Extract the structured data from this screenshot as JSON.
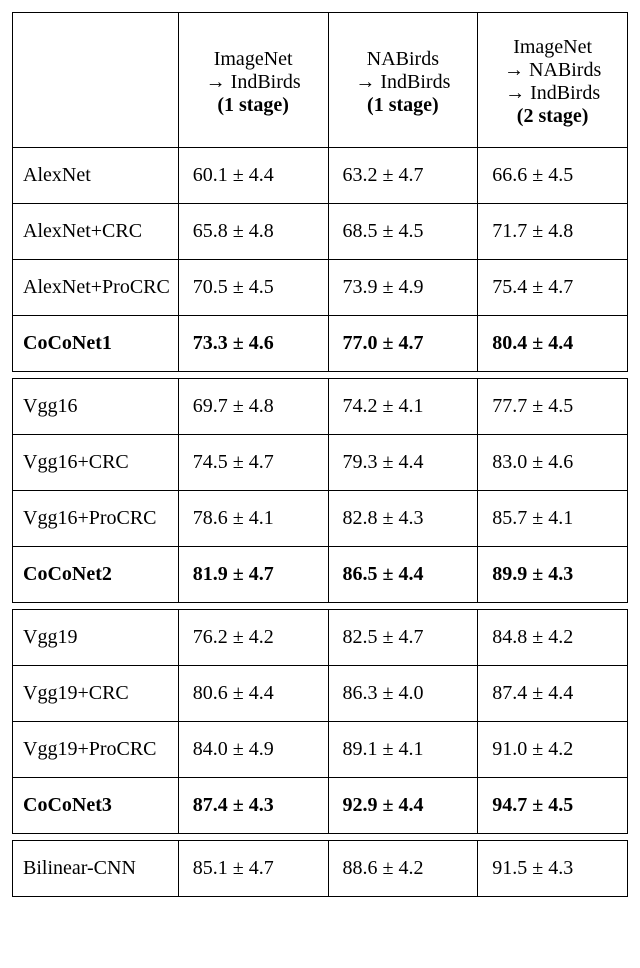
{
  "headers": {
    "method": "",
    "c1": {
      "l1": "ImageNet",
      "l2": "→ IndBirds",
      "l3": "(1 stage)"
    },
    "c2": {
      "l1": "NABirds",
      "l2": "→ IndBirds",
      "l3": "(1 stage)"
    },
    "c3": {
      "l1": "ImageNet",
      "l2": "→ NABirds",
      "l3": "→ IndBirds",
      "l4": "(2 stage)"
    }
  },
  "groups": [
    [
      {
        "name": "AlexNet",
        "v": [
          "60.1 ± 4.4",
          "63.2 ± 4.7",
          "66.6 ± 4.5"
        ],
        "bold": false
      },
      {
        "name": "AlexNet+CRC",
        "v": [
          "65.8 ± 4.8",
          "68.5 ± 4.5",
          "71.7 ± 4.8"
        ],
        "bold": false
      },
      {
        "name": "AlexNet+ProCRC",
        "v": [
          "70.5 ± 4.5",
          "73.9 ± 4.9",
          "75.4 ± 4.7"
        ],
        "bold": false
      },
      {
        "name": "CoCoNet1",
        "v": [
          "73.3 ± 4.6",
          "77.0 ± 4.7",
          "80.4 ± 4.4"
        ],
        "bold": true
      }
    ],
    [
      {
        "name": "Vgg16",
        "v": [
          "69.7 ± 4.8",
          "74.2 ± 4.1",
          "77.7 ± 4.5"
        ],
        "bold": false
      },
      {
        "name": "Vgg16+CRC",
        "v": [
          "74.5 ± 4.7",
          "79.3 ± 4.4",
          "83.0 ± 4.6"
        ],
        "bold": false
      },
      {
        "name": "Vgg16+ProCRC",
        "v": [
          "78.6 ± 4.1",
          "82.8 ± 4.3",
          "85.7 ± 4.1"
        ],
        "bold": false
      },
      {
        "name": "CoCoNet2",
        "v": [
          "81.9 ± 4.7",
          "86.5 ± 4.4",
          "89.9 ± 4.3"
        ],
        "bold": true
      }
    ],
    [
      {
        "name": "Vgg19",
        "v": [
          "76.2 ± 4.2",
          "82.5 ± 4.7",
          "84.8 ± 4.2"
        ],
        "bold": false
      },
      {
        "name": "Vgg19+CRC",
        "v": [
          "80.6 ± 4.4",
          "86.3 ± 4.0",
          "87.4 ± 4.4"
        ],
        "bold": false
      },
      {
        "name": "Vgg19+ProCRC",
        "v": [
          "84.0 ± 4.9",
          "89.1 ± 4.1",
          "91.0 ± 4.2"
        ],
        "bold": false
      },
      {
        "name": "CoCoNet3",
        "v": [
          "87.4 ± 4.3",
          "92.9 ± 4.4",
          "94.7 ± 4.5"
        ],
        "bold": true
      }
    ],
    [
      {
        "name": "Bilinear-CNN",
        "v": [
          "85.1 ± 4.7",
          "88.6 ± 4.2",
          "91.5 ± 4.3"
        ],
        "bold": false
      }
    ]
  ],
  "chart_data": {
    "type": "table",
    "columns": [
      "ImageNet → IndBirds (1 stage)",
      "NABirds → IndBirds (1 stage)",
      "ImageNet → NABirds → IndBirds (2 stage)"
    ],
    "rows": [
      {
        "method": "AlexNet",
        "values": [
          {
            "mean": 60.1,
            "std": 4.4
          },
          {
            "mean": 63.2,
            "std": 4.7
          },
          {
            "mean": 66.6,
            "std": 4.5
          }
        ]
      },
      {
        "method": "AlexNet+CRC",
        "values": [
          {
            "mean": 65.8,
            "std": 4.8
          },
          {
            "mean": 68.5,
            "std": 4.5
          },
          {
            "mean": 71.7,
            "std": 4.8
          }
        ]
      },
      {
        "method": "AlexNet+ProCRC",
        "values": [
          {
            "mean": 70.5,
            "std": 4.5
          },
          {
            "mean": 73.9,
            "std": 4.9
          },
          {
            "mean": 75.4,
            "std": 4.7
          }
        ]
      },
      {
        "method": "CoCoNet1",
        "values": [
          {
            "mean": 73.3,
            "std": 4.6
          },
          {
            "mean": 77.0,
            "std": 4.7
          },
          {
            "mean": 80.4,
            "std": 4.4
          }
        ]
      },
      {
        "method": "Vgg16",
        "values": [
          {
            "mean": 69.7,
            "std": 4.8
          },
          {
            "mean": 74.2,
            "std": 4.1
          },
          {
            "mean": 77.7,
            "std": 4.5
          }
        ]
      },
      {
        "method": "Vgg16+CRC",
        "values": [
          {
            "mean": 74.5,
            "std": 4.7
          },
          {
            "mean": 79.3,
            "std": 4.4
          },
          {
            "mean": 83.0,
            "std": 4.6
          }
        ]
      },
      {
        "method": "Vgg16+ProCRC",
        "values": [
          {
            "mean": 78.6,
            "std": 4.1
          },
          {
            "mean": 82.8,
            "std": 4.3
          },
          {
            "mean": 85.7,
            "std": 4.1
          }
        ]
      },
      {
        "method": "CoCoNet2",
        "values": [
          {
            "mean": 81.9,
            "std": 4.7
          },
          {
            "mean": 86.5,
            "std": 4.4
          },
          {
            "mean": 89.9,
            "std": 4.3
          }
        ]
      },
      {
        "method": "Vgg19",
        "values": [
          {
            "mean": 76.2,
            "std": 4.2
          },
          {
            "mean": 82.5,
            "std": 4.7
          },
          {
            "mean": 84.8,
            "std": 4.2
          }
        ]
      },
      {
        "method": "Vgg19+CRC",
        "values": [
          {
            "mean": 80.6,
            "std": 4.4
          },
          {
            "mean": 86.3,
            "std": 4.0
          },
          {
            "mean": 87.4,
            "std": 4.4
          }
        ]
      },
      {
        "method": "Vgg19+ProCRC",
        "values": [
          {
            "mean": 84.0,
            "std": 4.9
          },
          {
            "mean": 89.1,
            "std": 4.1
          },
          {
            "mean": 91.0,
            "std": 4.2
          }
        ]
      },
      {
        "method": "CoCoNet3",
        "values": [
          {
            "mean": 87.4,
            "std": 4.3
          },
          {
            "mean": 92.9,
            "std": 4.4
          },
          {
            "mean": 94.7,
            "std": 4.5
          }
        ]
      },
      {
        "method": "Bilinear-CNN",
        "values": [
          {
            "mean": 85.1,
            "std": 4.7
          },
          {
            "mean": 88.6,
            "std": 4.2
          },
          {
            "mean": 91.5,
            "std": 4.3
          }
        ]
      }
    ]
  }
}
